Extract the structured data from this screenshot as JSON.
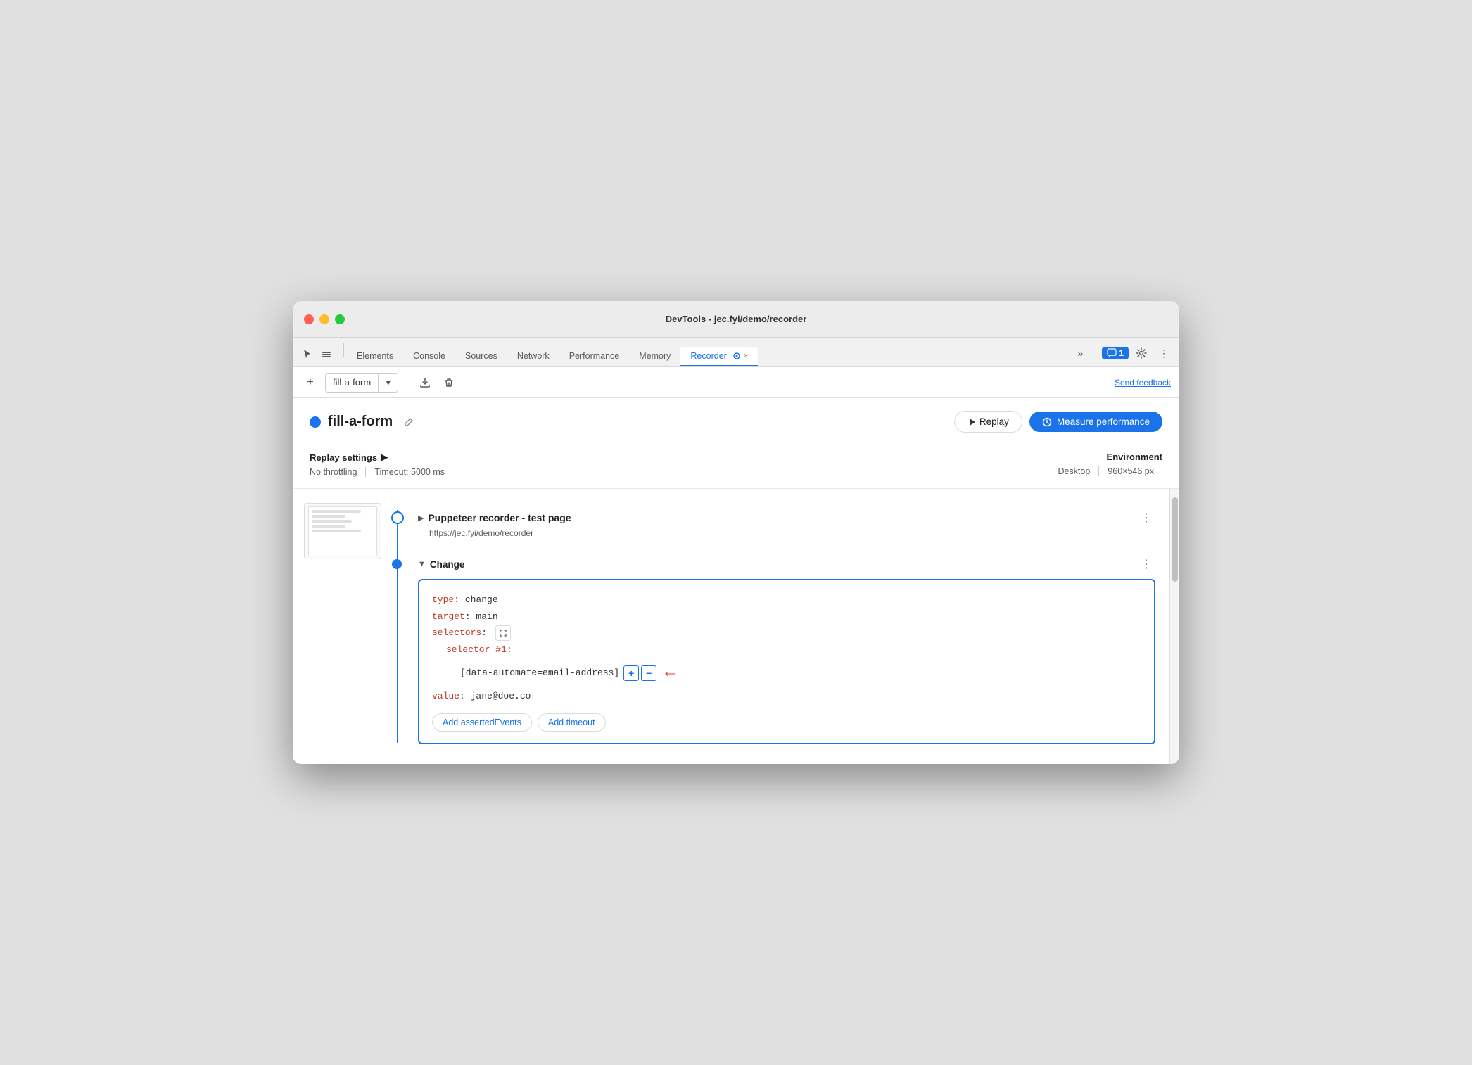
{
  "window": {
    "title": "DevTools - jec.fyi/demo/recorder"
  },
  "tabs": {
    "items": [
      {
        "label": "Elements",
        "active": false
      },
      {
        "label": "Console",
        "active": false
      },
      {
        "label": "Sources",
        "active": false
      },
      {
        "label": "Network",
        "active": false
      },
      {
        "label": "Performance",
        "active": false
      },
      {
        "label": "Memory",
        "active": false
      },
      {
        "label": "Recorder",
        "active": true
      }
    ],
    "more_label": "»",
    "chat_badge": "1",
    "recorder_close": "×"
  },
  "toolbar": {
    "add_label": "+",
    "recording_name": "fill-a-form",
    "download_title": "Export",
    "delete_title": "Delete",
    "send_feedback": "Send feedback"
  },
  "header": {
    "dot_color": "#1a73e8",
    "title": "fill-a-form",
    "edit_icon": "✎",
    "replay_label": "Replay",
    "measure_label": "Measure performance"
  },
  "settings": {
    "title": "Replay settings",
    "expand_icon": "▶",
    "throttling": "No throttling",
    "timeout": "Timeout: 5000 ms",
    "env_title": "Environment",
    "env_type": "Desktop",
    "env_size": "960×546 px"
  },
  "steps": {
    "step1": {
      "title": "Puppeteer recorder - test page",
      "url": "https://jec.fyi/demo/recorder"
    },
    "step2": {
      "title": "Change",
      "code": {
        "type_key": "type",
        "type_val": "change",
        "target_key": "target",
        "target_val": "main",
        "selectors_key": "selectors",
        "selector_num_key": "selector #1",
        "selector_val": "[data-automate=email-address]",
        "value_key": "value",
        "value_val": "jane@doe.co"
      },
      "btn_add_events": "Add assertedEvents",
      "btn_add_timeout": "Add timeout"
    }
  },
  "icons": {
    "cursor_icon": "⊹",
    "layers_icon": "⧉",
    "chevron_down": "▾",
    "play_icon": "▷",
    "measure_icon": "⟳",
    "pencil_icon": "✎",
    "download_icon": "⤓",
    "trash_icon": "🗑",
    "more_vert": "⋮",
    "gear_icon": "⚙",
    "dots_icon": "⋮",
    "collapse_icon": "▼",
    "expand_icon": "▶",
    "selector_icon": "⊹"
  }
}
